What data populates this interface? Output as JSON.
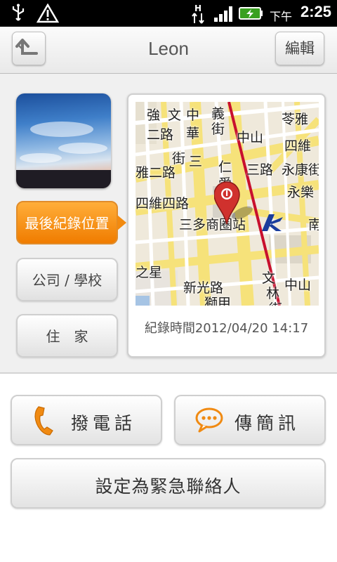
{
  "status_bar": {
    "ampm": "下午",
    "time": "2:25",
    "icons": [
      "usb-icon",
      "warning-icon",
      "hspa-data-icon",
      "signal-icon",
      "battery-charging-icon"
    ]
  },
  "header": {
    "title": "Leon",
    "back_icon": "back-arrow-icon",
    "edit_label": "編輯"
  },
  "location_buttons": [
    {
      "label": "最後紀錄位置",
      "active": true
    },
    {
      "label": "公司 / 學校",
      "active": false
    },
    {
      "label": "住　家",
      "active": false
    }
  ],
  "map": {
    "labels": [
      "強",
      "文",
      "中",
      "義",
      "苓雅",
      "二路",
      "華",
      "街",
      "中山",
      "四維",
      "雅二路",
      "街",
      "三",
      "仁",
      "三路",
      "永康街",
      "四維四路",
      "愛",
      "永樂",
      "三多商圈站",
      "南",
      "之星",
      "新光路",
      "文",
      "林",
      "中山",
      "獅甲",
      "街"
    ],
    "station_label": "三多商圈站",
    "record_time": "紀錄時間2012/04/20 14:17"
  },
  "actions": {
    "call_label": "撥電話",
    "sms_label": "傳簡訊",
    "emergency_label": "設定為緊急聯絡人"
  },
  "colors": {
    "accent_orange": "#f28a10",
    "call_icon": "#f08a12",
    "sms_icon": "#f08a12",
    "map_marker": "#d0312d",
    "metro_line": "#c8102e"
  }
}
